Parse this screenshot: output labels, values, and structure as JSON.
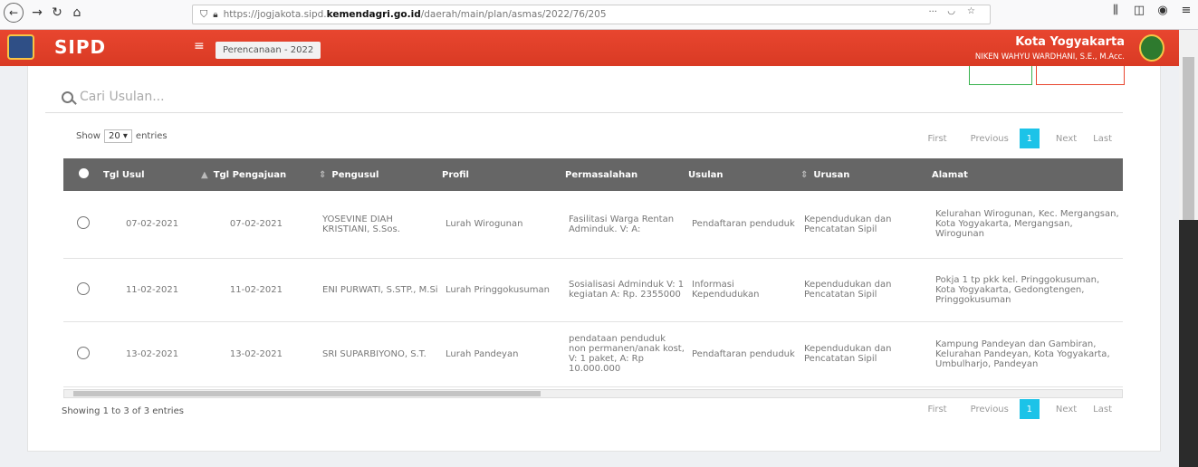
{
  "browser": {
    "url_prefix": "https://jogjakota.sipd.",
    "url_domain": "kemendagri.go.id",
    "url_path": "/daerah/main/plan/asmas/2022/76/205",
    "more": "···"
  },
  "header": {
    "brand": "SIPD",
    "menu": "Perencanaan - 2022",
    "kota": "Kota Yogyakarta",
    "user": "NIKEN WAHYU WARDHANI, S.E., M.Acc."
  },
  "search": {
    "placeholder": "Cari Usulan..."
  },
  "show": {
    "prefix": "Show",
    "value": "20",
    "suffix": "entries"
  },
  "pager": {
    "first": "First",
    "previous": "Previous",
    "page": "1",
    "next": "Next",
    "last": "Last"
  },
  "table": {
    "headers": [
      "Tgl Usul",
      "Tgl Pengajuan",
      "Pengusul",
      "Profil",
      "Permasalahan",
      "Usulan",
      "Urusan",
      "Alamat"
    ],
    "rows": [
      {
        "tgl_usul": "07-02-2021",
        "tgl_pengajuan": "07-02-2021",
        "pengusul": "YOSEVINE DIAH KRISTIANI, S.Sos.",
        "profil": "Lurah Wirogunan",
        "permasalahan": "Fasilitasi Warga Rentan Adminduk. V: A:",
        "usulan": "Pendaftaran penduduk",
        "urusan": "Kependudukan dan Pencatatan Sipil",
        "alamat": "Kelurahan Wirogunan, Kec. Mergangsan, Kota Yogyakarta, Mergangsan, Wirogunan"
      },
      {
        "tgl_usul": "11-02-2021",
        "tgl_pengajuan": "11-02-2021",
        "pengusul": "ENI PURWATI, S.STP., M.Si",
        "profil": "Lurah Pringgokusuman",
        "permasalahan": "Sosialisasi Adminduk V: 1 kegiatan A: Rp. 2355000",
        "usulan": "Informasi Kependudukan",
        "urusan": "Kependudukan dan Pencatatan Sipil",
        "alamat": "Pokja 1 tp pkk kel. Pringgokusuman, Kota Yogyakarta, Gedongtengen, Pringgokusuman"
      },
      {
        "tgl_usul": "13-02-2021",
        "tgl_pengajuan": "13-02-2021",
        "pengusul": "SRI SUPARBIYONO, S.T.",
        "profil": "Lurah Pandeyan",
        "permasalahan": "pendataan penduduk non permanen/anak kost, V: 1 paket, A: Rp 10.000.000",
        "usulan": "Pendaftaran penduduk",
        "urusan": "Kependudukan dan Pencatatan Sipil",
        "alamat": "Kampung Pandeyan dan Gambiran, Kelurahan Pandeyan, Kota Yogyakarta, Umbulharjo, Pandeyan"
      }
    ]
  },
  "footer": {
    "info": "Showing 1 to 3 of 3 entries"
  }
}
